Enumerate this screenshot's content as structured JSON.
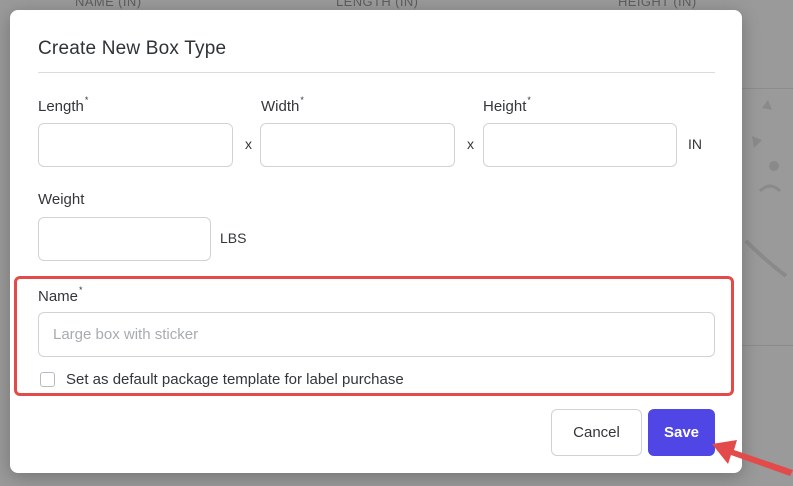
{
  "background": {
    "columns": [
      "NAME (IN)",
      "LENGTH (IN)",
      "HEIGHT (IN)"
    ]
  },
  "modal": {
    "title": "Create New Box Type",
    "length": {
      "label": "Length",
      "required_mark": "*",
      "value": ""
    },
    "width": {
      "label": "Width",
      "required_mark": "*",
      "value": ""
    },
    "height": {
      "label": "Height",
      "required_mark": "*",
      "value": ""
    },
    "dimension_separator": "x",
    "dimension_unit": "IN",
    "weight": {
      "label": "Weight",
      "value": "",
      "unit": "LBS"
    },
    "name": {
      "label": "Name",
      "required_mark": "*",
      "placeholder": "Large box with sticker",
      "value": ""
    },
    "default_checkbox": {
      "label": "Set as default package template for label purchase",
      "checked": false
    },
    "cancel_label": "Cancel",
    "save_label": "Save"
  },
  "colors": {
    "primary": "#4f46e5",
    "highlight": "#e34b4b"
  }
}
